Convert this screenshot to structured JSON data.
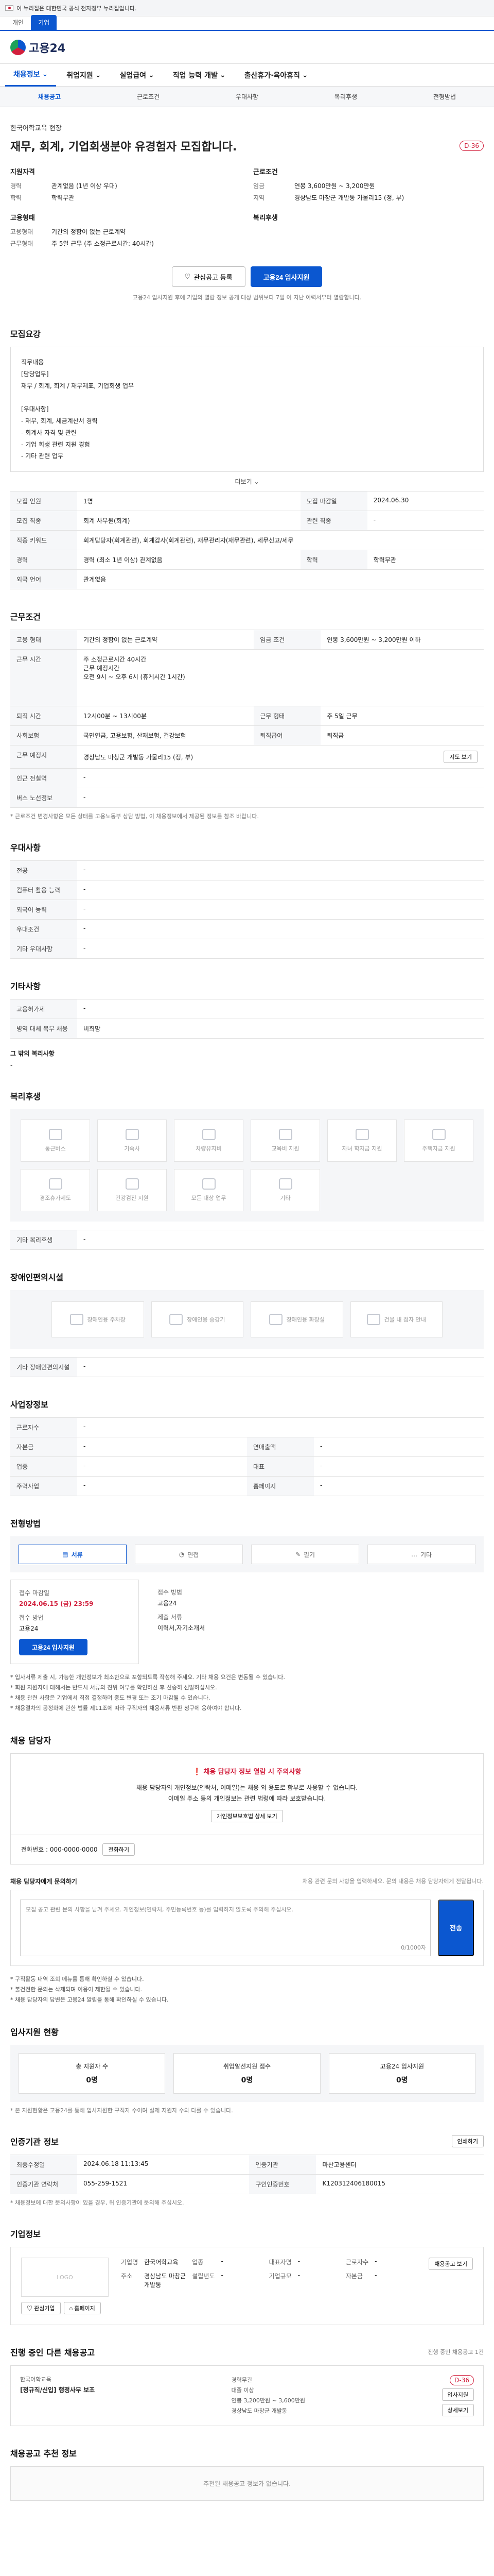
{
  "gov_banner": {
    "text": "이 누리집은 대한민국 공식 전자정부 누리집입니다."
  },
  "site_tabs": [
    "개인",
    "기업"
  ],
  "header": {
    "logo_text": "고용24"
  },
  "gnb": [
    "채용정보",
    "취업지원",
    "실업급여",
    "직업 능력 개발",
    "출산휴가·육아휴직"
  ],
  "subnav": [
    "채용공고",
    "근로조건",
    "우대사항",
    "복리후생",
    "전형방법"
  ],
  "job": {
    "company": "한국어학교육 현장",
    "title": "재무, 회계, 기업회생분야 유경험자 모집합니다.",
    "dday": "D-36",
    "left_heading": "지원자격",
    "left": [
      {
        "k": "경력",
        "v": "관계없음 (1년 이상 우대)"
      },
      {
        "k": "학력",
        "v": "학력무관"
      }
    ],
    "left2_heading": "고용형태",
    "left2": [
      {
        "k": "고용형태",
        "v": "기간의 정함이 없는 근로계약"
      },
      {
        "k": "근무형태",
        "v": "주 5일 근무 (주 소정근로시간: 40시간)"
      }
    ],
    "right_heading": "근로조건",
    "right": [
      {
        "k": "임금",
        "v": "연봉 3,600만원 ~ 3,200만원"
      },
      {
        "k": "지역",
        "v": "경상남도 마창군 개발동 가물리15 (정, 부)"
      }
    ],
    "right2_heading": "복리후생",
    "interest_btn": "관심공고 등록",
    "apply_btn": "고용24 입사지원",
    "notice": "고용24 입사지원 후에 기업의 열람 정보 공개 대상 범위보다 7일 이 지난 이력서부터 열람합니다."
  },
  "recruit": {
    "title": "모집요강",
    "desc": "직무내용\n[담당업무]\n재무 / 회계, 회계 / 재무제표, 기업회생 업무\n\n[우대사항]\n- 재무, 회계, 세금계산서 경력\n- 회계사 자격 및 관련\n- 기업 회생 관련 지원 경험\n- 기타 관련 업무",
    "more": "더보기",
    "rows": [
      [
        {
          "k": "모집 인원",
          "v": "1명"
        },
        {
          "k": "모집 마감일",
          "v": "2024.06.30"
        }
      ],
      [
        {
          "k": "모집 직종",
          "v": "회계 사무원(회계)"
        },
        {
          "k": "관련 직종",
          "v": "-"
        }
      ],
      [
        {
          "k": "직종 키워드",
          "v": "회계담당자(회계관련), 회계감사(회계관련), 재무관리자(재무관련), 세무신고/세무"
        },
        {
          "k": "",
          "v": ""
        }
      ],
      [
        {
          "k": "경력",
          "v": "경력 (최소 1년 이상) 관계없음"
        },
        {
          "k": "학력",
          "v": "학력무관"
        }
      ],
      [
        {
          "k": "외국 언어",
          "v": "관계없음"
        },
        {
          "k": "",
          "v": ""
        }
      ]
    ]
  },
  "conditions": {
    "title": "근무조건",
    "rows": [
      [
        {
          "k": "고용 형태",
          "v": "기간의 정함이 없는 근로계약"
        },
        {
          "k": "임금 조건",
          "v": "연봉 3,600만원 ~ 3,200만원 이하"
        }
      ],
      [
        {
          "k": "근무 시간",
          "v": "주 소정근로시간 40시간\n근무 예정시간\n오전 9시 ~ 오후 6시 (휴게시간 1시간)"
        },
        {
          "k": "",
          "v": ""
        }
      ],
      [
        {
          "k": "퇴직 시간",
          "v": "12시00분 ~ 13시00분"
        },
        {
          "k": "근무 형태",
          "v": "주 5일 근무"
        }
      ],
      [
        {
          "k": "사회보험",
          "v": "국민연금, 고용보험, 산재보험, 건강보험"
        },
        {
          "k": "퇴직급여",
          "v": "퇴직금"
        }
      ],
      [
        {
          "k": "근무 예정지",
          "v": "경상남도 마창군 개발동 가물리15 (정, 부)"
        },
        {
          "k": "",
          "v": ""
        }
      ],
      [
        {
          "k": "인근 전철역",
          "v": "-"
        },
        {
          "k": "",
          "v": ""
        }
      ],
      [
        {
          "k": "버스 노선정보",
          "v": "-"
        },
        {
          "k": "",
          "v": ""
        }
      ]
    ],
    "map_btn": "지도 보기",
    "hint": "* 근로조건 변경사항은 모든 상태를 고용노동부 상담 방법, 이 채용정보에서 제공된 정보를 참조 바랍니다."
  },
  "preference": {
    "title": "우대사항",
    "rows": [
      {
        "k": "전공",
        "v": "-"
      },
      {
        "k": "컴퓨터 활용 능력",
        "v": "-"
      },
      {
        "k": "외국어 능력",
        "v": "-"
      },
      {
        "k": "우대조건",
        "v": "-"
      },
      {
        "k": "기타 우대사항",
        "v": "-"
      }
    ]
  },
  "etc": {
    "title": "기타사항",
    "rows": [
      {
        "k": "고용허가제",
        "v": "-"
      },
      {
        "k": "병역 대체 복무 채용",
        "v": "비희망"
      }
    ],
    "extra_heading": "그 밖의 복리사항",
    "extra_value": "-"
  },
  "welfare": {
    "title": "복리후생",
    "items": [
      "통근버스",
      "기숙사",
      "차량유지비",
      "교육비 지원",
      "자녀 학자금 지원",
      "주택자금 지원",
      "경조휴가제도",
      "건강검진 지원",
      "모든 대상 업무",
      "기타"
    ],
    "etc_heading": "기타 복리후생",
    "etc_value": "-"
  },
  "disability": {
    "title": "장애인편의시설",
    "items": [
      "장애인용 주차장",
      "장애인용 승강기",
      "장애인용 화장실",
      "건물 내 점자 안내"
    ],
    "etc_heading": "기타 장애인편의시설",
    "etc_value": "-"
  },
  "workplace": {
    "title": "사업장정보",
    "rows": [
      [
        {
          "k": "근로자수",
          "v": "-"
        },
        {
          "k": "",
          "v": ""
        }
      ],
      [
        {
          "k": "자본금",
          "v": "-"
        },
        {
          "k": "연매출액",
          "v": "-"
        }
      ],
      [
        {
          "k": "업종",
          "v": "-"
        },
        {
          "k": "대표",
          "v": "-"
        }
      ],
      [
        {
          "k": "주력사업",
          "v": "-"
        },
        {
          "k": "홈페이지",
          "v": "-"
        }
      ]
    ]
  },
  "process": {
    "title": "전형방법",
    "steps": [
      "서류",
      "면접",
      "필기",
      "기타"
    ],
    "card1": {
      "label": "접수 마감일",
      "value": "2024.06.15 (금) 23:59",
      "label2": "접수 방법",
      "value2": "고용24",
      "btn": "고용24 입사지원"
    },
    "card2": {
      "label": "접수 방법",
      "value": "고용24",
      "label2": "제출 서류",
      "value2": "이력서,자기소개서"
    },
    "bullets": [
      "* 입사서류 제출 시, 가능한 개인정보가 최소한으로 포함되도록 작성해 주세요. 기타 채용 요건은 변동될 수 있습니다.",
      "* 회원 지원자에 대해서는 반드시 서류의 진위 여부를 확인하신 후 신중히 선발하십시오.",
      "* 채용 관련 사항은 기업에서 직접 결정하며 중도 변경 또는 조기 마감될 수 있습니다.",
      "* 채용절차의 공정화에 관한 법률 제11조에 따라 구직자의 채용서류 반환 청구에 응하여야 합니다."
    ]
  },
  "manager": {
    "title": "채용 담당자",
    "warn": "채용 담당자 정보 열람 시 주의사항",
    "text": "채용 담당자의 개인정보(연락처, 이메일)는 채용 외 용도로 함부로 사용할 수 없습니다.\n이메일 주소 등의 개인정보는 관련 법령에 따라 보호받습니다.",
    "btn": "개인정보보호법 상세 보기",
    "phone_label": "전화번호 : 000-0000-0000",
    "phone_btn": "전화하기",
    "inquiry_title": "채용 담당자에게 문의하기",
    "inquiry_hint": "채용 관련 문의 사항을 입력하세요. 문의 내용은 채용 담당자에게 전달됩니다.",
    "placeholder": "모집 공고 관련 문의 사항을 남겨 주세요. 개인정보(연락처, 주민등록번호 등)를 입력하지 않도록 주의해 주십시오.",
    "count": "0/1000자",
    "send": "전송",
    "bullets": [
      "* 구직활동 내역 조회 메뉴를 통해 확인하실 수 있습니다.",
      "* 불건전한 문의는 삭제되며 이용이 제한될 수 있습니다.",
      "* 채용 담당자의 답변은 고용24 알림을 통해 확인하실 수 있습니다."
    ]
  },
  "status": {
    "title": "입사지원 현황",
    "cards": [
      {
        "label": "총 지원자 수",
        "value": "0명"
      },
      {
        "label": "취업알선지원 접수",
        "value": "0명"
      },
      {
        "label": "고용24 입사지원",
        "value": "0명"
      }
    ],
    "hint": "* 본 지원현황은 고용24를 통해 입사지원한 구직자 수이며 실제 지원자 수와 다를 수 있습니다."
  },
  "auth": {
    "title": "인증기관 정보",
    "print_btn": "인쇄하기",
    "rows": [
      [
        {
          "k": "최종수정일",
          "v": "2024.06.18 11:13:45"
        },
        {
          "k": "인증기관",
          "v": "마산고용센터"
        }
      ],
      [
        {
          "k": "인증기관 연락처",
          "v": "055-259-1521"
        },
        {
          "k": "구인인증번호",
          "v": "K120312406180015"
        }
      ]
    ],
    "hint": "* 채용정보에 대한 문의사항이 있을 경우, 위 인증기관에 문의해 주십시오."
  },
  "company_info": {
    "title": "기업정보",
    "logo_text": "LOGO",
    "fields": [
      {
        "k": "기업명",
        "v": "한국어학교육"
      },
      {
        "k": "업종",
        "v": "-"
      },
      {
        "k": "대표자명",
        "v": "-"
      },
      {
        "k": "근로자수",
        "v": "-"
      },
      {
        "k": "주소",
        "v": "경상남도 마창군 개발동"
      },
      {
        "k": "설립년도",
        "v": "-"
      },
      {
        "k": "기업규모",
        "v": "-"
      },
      {
        "k": "자본금",
        "v": "-"
      }
    ],
    "btn1": "관심기업",
    "btn2": "홈페이지",
    "more_btn": "채용공고 보기"
  },
  "other_jobs": {
    "title": "진행 중인 다른 채용공고",
    "count_text": "진행 중인 채용공고 1건",
    "company": "한국어학교육",
    "job_title": "[정규직/신입] 행정사무 보조",
    "info": [
      "경력무관",
      "대졸 이상",
      "연봉 3,200만원 ~ 3,600만원",
      "경상남도 마창군 개발동"
    ],
    "dday": "D-36",
    "btn1": "입사지원",
    "btn2": "상세보기"
  },
  "recommend": {
    "title": "채용공고 추천 정보",
    "empty": "추천된 채용공고 정보가 없습니다."
  }
}
